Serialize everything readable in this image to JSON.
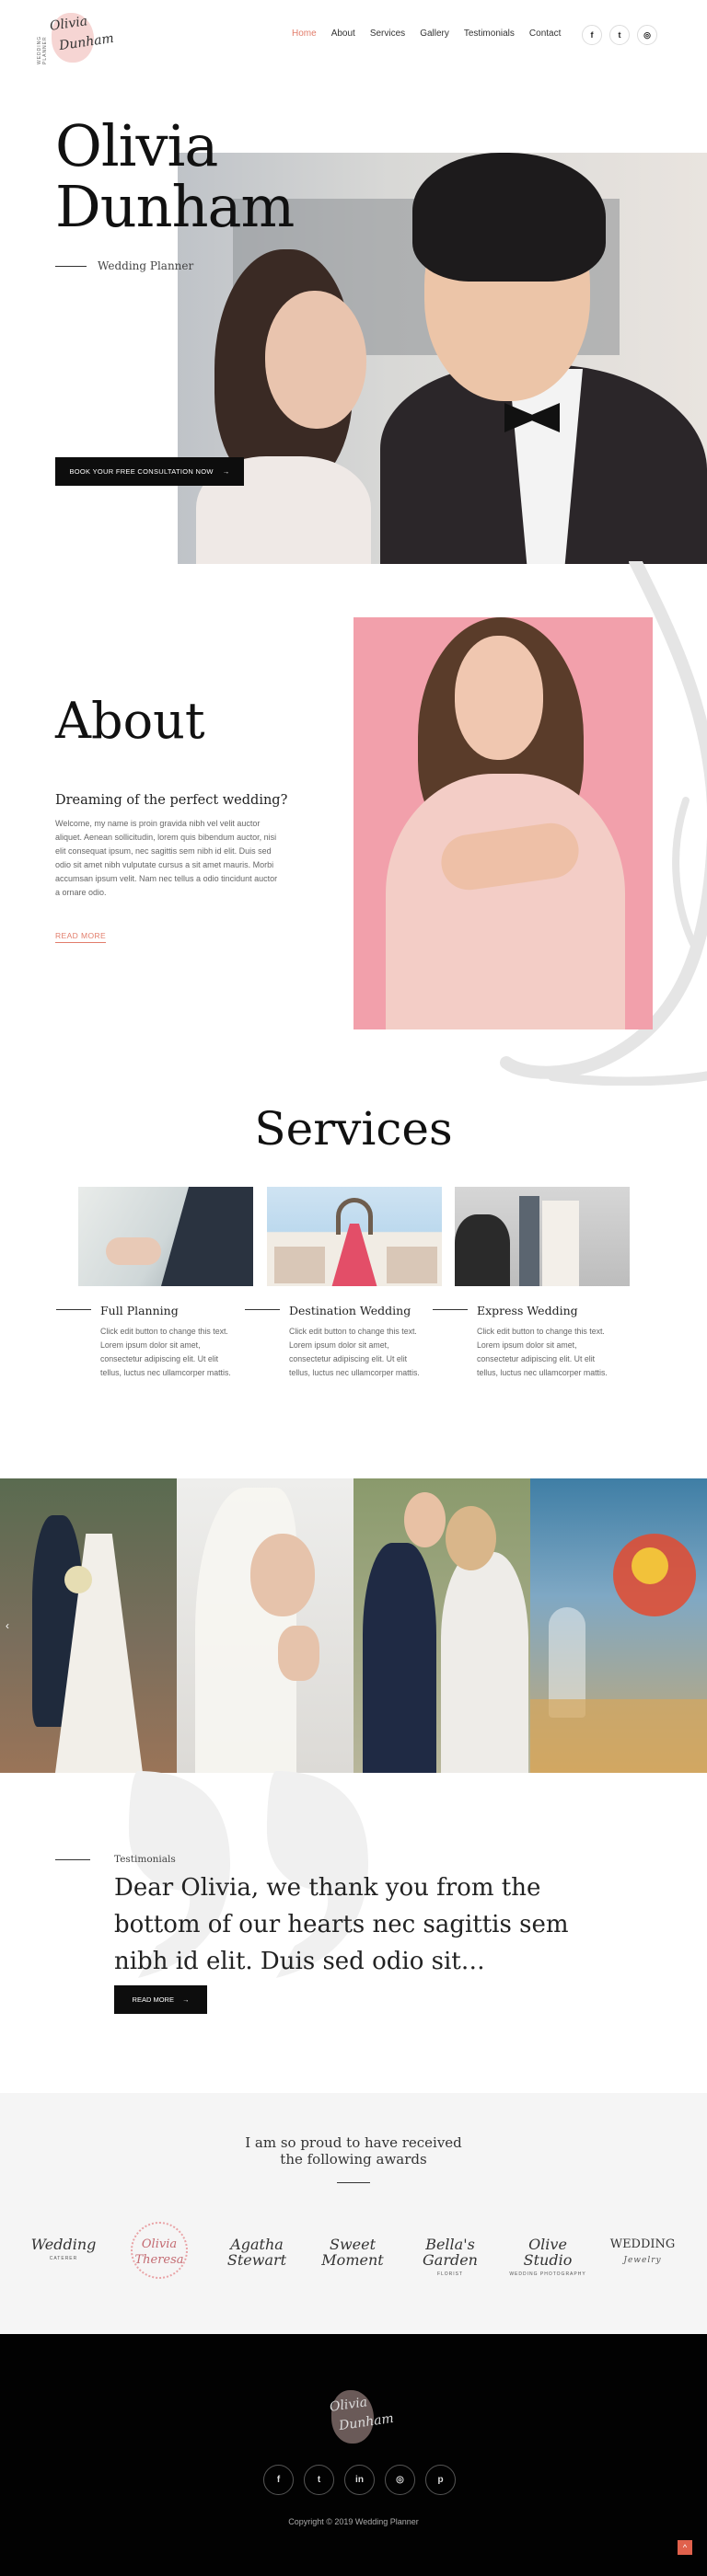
{
  "brand": {
    "logo_line1": "Olivia",
    "logo_line2": "Dunham",
    "logo_side": "WEDDING PLANNER"
  },
  "nav": {
    "items": [
      {
        "label": "Home",
        "active": true
      },
      {
        "label": "About"
      },
      {
        "label": "Services"
      },
      {
        "label": "Gallery"
      },
      {
        "label": "Testimonials"
      },
      {
        "label": "Contact"
      }
    ]
  },
  "social_top": {
    "facebook": "f",
    "twitter": "t",
    "instagram": "◎"
  },
  "hero": {
    "name_line1": "Olivia",
    "name_line2": "Dunham",
    "role": "Wedding Planner",
    "cta_label": "BOOK YOUR FREE CONSULTATION NOW",
    "cta_arrow": "→"
  },
  "about": {
    "title": "About",
    "subtitle": "Dreaming of the perfect wedding?",
    "body": "Welcome, my name is proin gravida nibh vel velit auctor aliquet. Aenean sollicitudin, lorem quis bibendum auctor, nisi elit consequat ipsum, nec sagittis sem nibh id elit. Duis sed odio sit amet nibh vulputate cursus a sit amet mauris. Morbi accumsan ipsum velit. Nam nec tellus a odio tincidunt auctor a ornare odio.",
    "read_more": "READ MORE"
  },
  "services": {
    "title": "Services",
    "items": [
      {
        "title": "Full Planning",
        "text": "Click edit button to change this text. Lorem ipsum dolor sit amet, consectetur adipiscing elit. Ut elit tellus, luctus nec ullamcorper mattis."
      },
      {
        "title": "Destination Wedding",
        "text": "Click edit button to change this text. Lorem ipsum dolor sit amet, consectetur adipiscing elit. Ut elit tellus, luctus nec ullamcorper mattis."
      },
      {
        "title": "Express Wedding",
        "text": "Click edit button to change this text. Lorem ipsum dolor sit amet, consectetur adipiscing elit. Ut elit tellus, luctus nec ullamcorper mattis."
      }
    ]
  },
  "gallery": {
    "prev_arrow": "‹"
  },
  "testimonial": {
    "label": "Testimonials",
    "quote": "Dear Olivia, we thank you from the bottom of our hearts nec sagittis sem nibh id elit. Duis sed odio sit…",
    "btn_label": "READ MORE",
    "btn_arrow": "→"
  },
  "awards": {
    "title_line1": "I am so proud to have received",
    "title_line2": "the following awards",
    "items": [
      {
        "name": "Wedding",
        "small": "CATERER"
      },
      {
        "name": "Olivia Theresa",
        "small": ""
      },
      {
        "name": "Agatha Stewart",
        "small": ""
      },
      {
        "name": "Sweet Moment",
        "small": ""
      },
      {
        "name": "Bella's Garden",
        "small": "FLORIST"
      },
      {
        "name": "Olive Studio",
        "small": "WEDDING PHOTOGRAPHY"
      },
      {
        "name": "WEDDING",
        "small": "Jewelry"
      }
    ]
  },
  "footer": {
    "logo_line1": "Olivia",
    "logo_line2": "Dunham",
    "social": [
      "f",
      "t",
      "in",
      "◎",
      "p"
    ],
    "copyright": "Copyright © 2019 Wedding Planner",
    "to_top": "^"
  },
  "colors": {
    "accent": "#e27d6b",
    "dark": "#0d0d0d",
    "footer_bg": "#020202",
    "awards_bg": "#f5f5f5",
    "about_photo_bg": "#f2a0ab"
  }
}
